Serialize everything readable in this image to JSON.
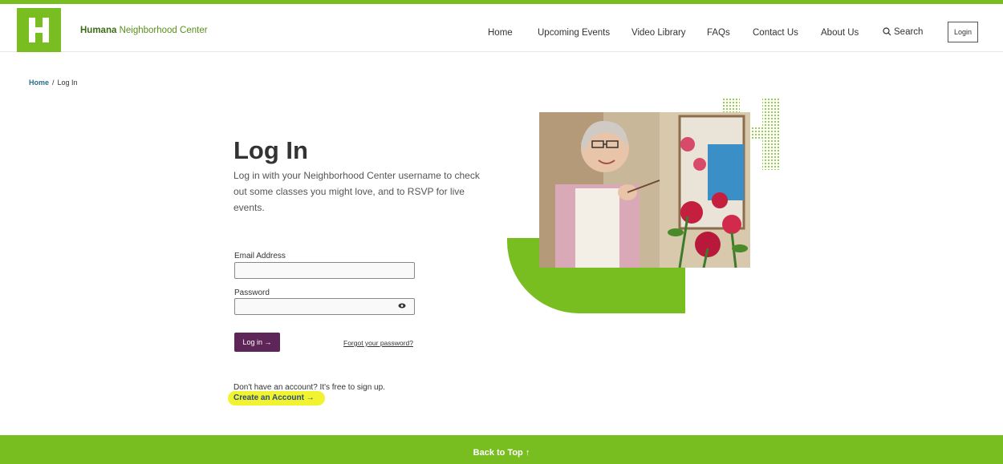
{
  "brand": {
    "name_bold": "Humana",
    "name_rest": "Neighborhood Center",
    "logo_letter": "H",
    "color": "#78be20"
  },
  "nav": {
    "items": [
      "Home",
      "Upcoming Events",
      "Video Library",
      "FAQs",
      "Contact Us",
      "About Us"
    ],
    "search_label": "Search",
    "login_label": "Login"
  },
  "breadcrumb": {
    "home": "Home",
    "separator": "/",
    "current": "Log In"
  },
  "main": {
    "title": "Log In",
    "intro": "Log in with your Neighborhood Center username to check out some classes you might love, and to RSVP for live events.",
    "email_label": "Email Address",
    "email_value": "",
    "password_label": "Password",
    "password_value": "",
    "submit_label": "Log in →",
    "forgot_label": "Forgot your password?",
    "no_account_text": "Don't have an account? It's free to sign up.",
    "create_account_label": "Create an Account →"
  },
  "footer": {
    "back_to_top": "Back to Top ↑"
  },
  "colors": {
    "accent_green": "#78be20",
    "button_purple": "#5e2558",
    "highlight_yellow": "#f0f21a"
  }
}
